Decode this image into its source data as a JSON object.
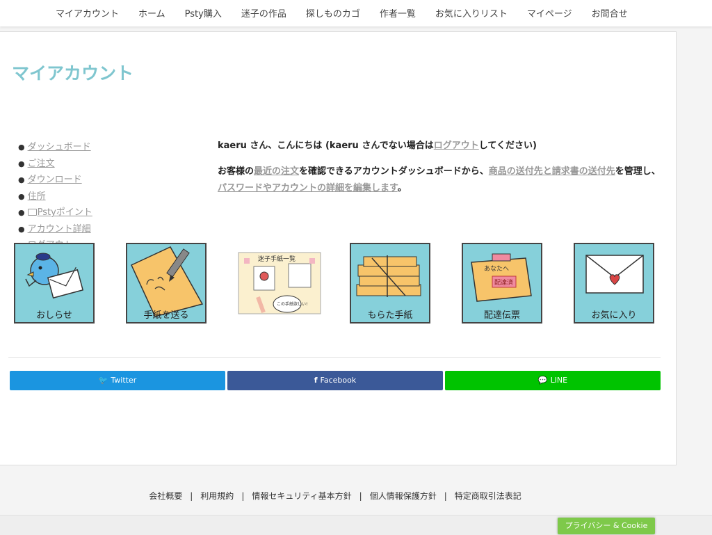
{
  "topnav": {
    "items": [
      "マイアカウント",
      "ホーム",
      "Psty購入",
      "迷子の作品",
      "探しものカゴ",
      "作者一覧",
      "お気に入りリスト",
      "マイページ",
      "お問合せ"
    ]
  },
  "page": {
    "title": "マイアカウント"
  },
  "account_nav": {
    "items": [
      "ダッシュボード",
      "ご注文",
      "ダウンロード",
      "住所",
      "Pstyポイント",
      "アカウント詳細",
      "ログアウト"
    ]
  },
  "greeting": {
    "user": "kaeru",
    "text1": " さん、こんにちは (",
    "text2": " さんでない場合は",
    "logout": "ログアウト",
    "text3": "してください)"
  },
  "dashboard": {
    "p1": "お客様の",
    "recent_orders": "最近の注文",
    "p2": "を確認できるアカウントダッシュボードから、",
    "addresses": "商品の送付先と請求書の送付先",
    "p3": "を管理し、",
    "edit": "パスワードやアカウントの詳細を編集します",
    "p4": "。"
  },
  "tiles": [
    {
      "caption": "おしらせ",
      "icon": "bird-letter-icon"
    },
    {
      "caption": "手紙を送る",
      "icon": "pencil-letter-icon"
    },
    {
      "caption": "",
      "icon": "letter-board-icon",
      "board_title": "迷子手紙一覧",
      "bubble": "この手紙欲しい!"
    },
    {
      "caption": "もらた手紙",
      "icon": "letter-stack-icon"
    },
    {
      "caption": "配達伝票",
      "icon": "delivery-slip-icon",
      "slip_text": "あなたへ",
      "stamp": "配達済"
    },
    {
      "caption": "お気に入り",
      "icon": "heart-envelope-icon"
    }
  ],
  "share": {
    "twitter": "Twitter",
    "facebook": "Facebook",
    "line": "LINE",
    "colors": {
      "twitter": "#1b95e0",
      "facebook": "#3b5998",
      "line": "#00c300"
    }
  },
  "footer": {
    "links": [
      "会社概要",
      "利用規約",
      "情報セキュリティ基本方針",
      "個人情報保護方針",
      "特定商取引法表記"
    ]
  },
  "privacy_button": "プライバシー & Cookie"
}
